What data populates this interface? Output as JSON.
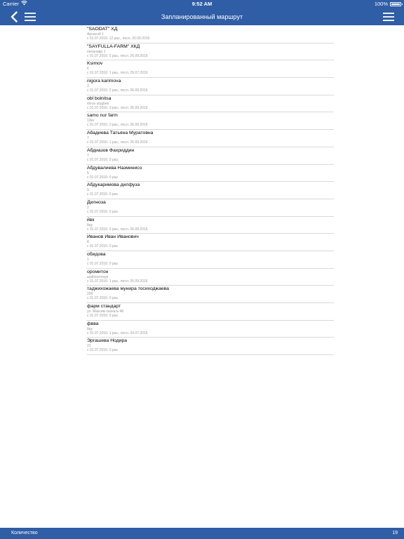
{
  "status_bar": {
    "carrier": "Carrier",
    "time": "9:52 AM",
    "battery": "100%",
    "battery_level": 1.0
  },
  "nav": {
    "title": "Запланированный маршрут",
    "back_icon": "back-chevron-icon",
    "menu_icon": "hamburger-menu-icon"
  },
  "route": {
    "items": [
      {
        "name": "\"SAODAT\" ХД",
        "address": "Арнасой 1",
        "visits": "с 01.07.2016: 12 раз., посл. 26.09.2016"
      },
      {
        "name": "\"SAYFULLA-FARM\" ХКД",
        "address": "пиланавр 1",
        "visits": "с 01.07.2016: 5 раз., посл. 26.09.2016"
      },
      {
        "name": "Ksimov",
        "address": "6",
        "visits": "с 01.07.2016: 1 раз., посл. 29.07.2016"
      },
      {
        "name": "nigora karimova",
        "address": "3",
        "visits": "с 01.07.2016: 2 раз., посл. 26.09.2016"
      },
      {
        "name": "obl bolnitsa",
        "address": "mirzo ulugbek",
        "visits": "с 01.07.2016: 3 раз., посл. 26.09.2016"
      },
      {
        "name": "samo nur farm",
        "address": "13kv",
        "visits": "с 01.07.2016: 3 раз., посл. 26.09.2016"
      },
      {
        "name": "Абадиева Татьяна Муратовна",
        "address": "7",
        "visits": "с 01.07.2016: 1 раз., посл. 26.09.2016"
      },
      {
        "name": "Абдиазов Фахриддин",
        "address": "7",
        "visits": "с 01.07.2016: 0 раз."
      },
      {
        "name": "Абдувалиева Назминисо",
        "address": "5",
        "visits": "с 01.07.2016: 0 раз."
      },
      {
        "name": "Абдукаримова дилфуза",
        "address": "0",
        "visits": "с 01.07.2016: 0 раз."
      },
      {
        "name": "Дилноза",
        "address": "2",
        "visits": "с 01.07.2016: 0 раз."
      },
      {
        "name": "йвк",
        "address": "йцу",
        "visits": "с 01.07.2016: 3 раз., посл. 26.09.2016"
      },
      {
        "name": "Иванов Иван Иванович",
        "address": "8",
        "visits": "с 01.07.2016: 0 раз."
      },
      {
        "name": "обидова",
        "address": "1",
        "visits": "с 01.07.2016: 0 раз."
      },
      {
        "name": "оромитон",
        "address": "шайхонтохур",
        "visits": "с 01.07.2016: 1 раз., посл. 26.09.2016"
      },
      {
        "name": "таджихожаева мунира тосиходжаева",
        "address": "204",
        "visits": "с 01.07.2016: 0 раз."
      },
      {
        "name": "фарм стандарт",
        "address": "ул. Максим скачать 48",
        "visits": "с 01.07.2016: 0 раз."
      },
      {
        "name": "фвва",
        "address": "йцу",
        "visits": "с 01.07.2016: 1 раз., посл. 04.07.2016"
      },
      {
        "name": "Эргашева Нодира",
        "address": "21",
        "visits": "с 01.07.2016: 0 раз."
      }
    ]
  },
  "footer": {
    "label": "Количество",
    "count": "19"
  },
  "colors": {
    "bar_blue": "#2f5da6",
    "separator": "#d9d9d9",
    "secondary_text": "#9a9a9a"
  }
}
